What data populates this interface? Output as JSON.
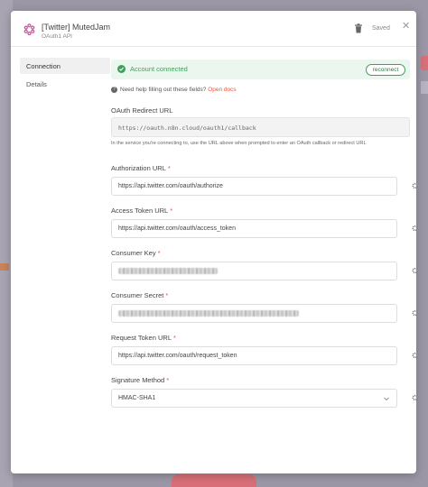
{
  "header": {
    "title": "[Twitter] MutedJam",
    "subtitle": "OAuth1 API",
    "saved_label": "Saved",
    "logo_icon": "n8n-logo-icon",
    "delete_icon": "trash-icon",
    "close_icon": "close-icon"
  },
  "sidebar": {
    "items": [
      {
        "label": "Connection",
        "active": true
      },
      {
        "label": "Details",
        "active": false
      }
    ]
  },
  "banner": {
    "text": "Account connected",
    "button_label": "reconnect",
    "color": "#3f9e5c"
  },
  "help": {
    "text": "Need help filling out these fields?",
    "link_label": "Open docs"
  },
  "fields": {
    "redirect": {
      "label": "OAuth Redirect URL",
      "value": "https://oauth.n8n.cloud/oauth1/callback",
      "hint": "In the service you're connecting to, use the URL above when prompted to enter an OAuth callback or redirect URL"
    },
    "authorization_url": {
      "label": "Authorization URL",
      "required": "*",
      "value": "https://api.twitter.com/oauth/authorize"
    },
    "access_token_url": {
      "label": "Access Token URL",
      "required": "*",
      "value": "https://api.twitter.com/oauth/access_token"
    },
    "consumer_key": {
      "label": "Consumer Key",
      "required": "*",
      "value": ""
    },
    "consumer_secret": {
      "label": "Consumer Secret",
      "required": "*",
      "value": ""
    },
    "request_token_url": {
      "label": "Request Token URL",
      "required": "*",
      "value": "https://api.twitter.com/oauth/request_token"
    },
    "signature_method": {
      "label": "Signature Method",
      "required": "*",
      "value": "HMAC-SHA1"
    }
  },
  "colors": {
    "accent": "#e0593c",
    "success": "#3f9e5c",
    "brand": "#d14ba0"
  }
}
